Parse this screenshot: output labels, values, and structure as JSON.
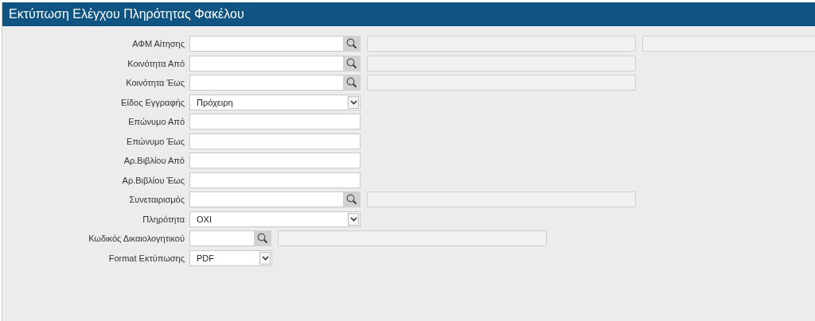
{
  "window": {
    "title": "Εκτύπωση Ελέγχου Πληρότητας Φακέλου"
  },
  "fields": [
    {
      "label": "ΑΦΜ Αίτησης",
      "kind": "lookup-double"
    },
    {
      "label": "Κοινότητα Από",
      "kind": "lookup"
    },
    {
      "label": "Κοινότητα Έως",
      "kind": "lookup"
    },
    {
      "label": "Είδος Εγγραφής",
      "kind": "select",
      "value": "Πρόχειρη"
    },
    {
      "label": "Επώνυμο Από",
      "kind": "text"
    },
    {
      "label": "Επώνυμο Έως",
      "kind": "text"
    },
    {
      "label": "Αρ.Βιβλίου Από",
      "kind": "text"
    },
    {
      "label": "Αρ.Βιβλίου Έως",
      "kind": "text"
    },
    {
      "label": "Συνεταιρισμός",
      "kind": "lookup"
    },
    {
      "label": "Πληρότητα",
      "kind": "select",
      "value": "ΟΧΙ"
    },
    {
      "label": "Κωδικός Δικαιολογητικού",
      "kind": "lookup-short"
    },
    {
      "label": "Format Εκτύπωσης",
      "kind": "select-short",
      "value": "PDF"
    }
  ]
}
